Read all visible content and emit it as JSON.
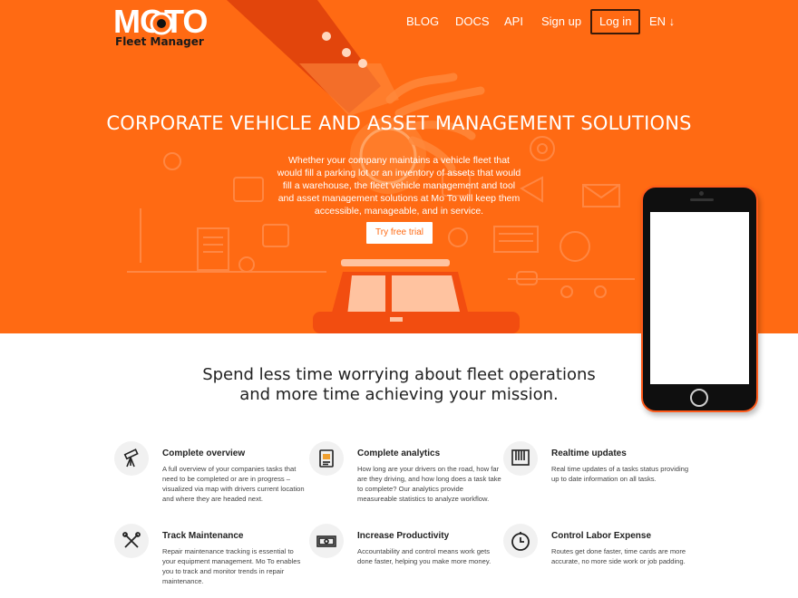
{
  "header": {
    "logo_text": "MOTO",
    "logo_sub": "Fleet Manager",
    "nav": {
      "blog": "BLOG",
      "docs": "DOCS",
      "api": "API",
      "signup": "Sign up",
      "login": "Log in",
      "lang": "EN ↓"
    }
  },
  "hero": {
    "title": "CORPORATE VEHICLE AND ASSET MANAGEMENT SOLUTIONS",
    "text": "Whether your company maintains a vehicle fleet that would fill a parking lot or an inventory of assets that would fill a warehouse, the fleet vehicle management and tool and asset management solutions at Mo To will keep them accessible, manageable, and in service.",
    "cta": "Try free trial"
  },
  "section": {
    "headline_1": "Spend less time worrying about fleet operations",
    "headline_2": "and more time achieving your mission."
  },
  "features": [
    {
      "title": "Complete overview",
      "icon": "telescope-icon",
      "text": "A full overview of your companies tasks that need to be completed or are in progress – visualized via map with drivers current location and where they are headed next."
    },
    {
      "title": "Complete analytics",
      "icon": "report-icon",
      "text": "How long are your drivers on the road, how far are they driving, and how long does a task take to complete? Our analytics provide measureable statistics to analyze workflow."
    },
    {
      "title": "Realtime updates",
      "icon": "newtons-cradle-icon",
      "text": "Real time updates of a tasks status providing up to date information on all tasks."
    },
    {
      "title": "Track Maintenance",
      "icon": "tools-icon",
      "text": "Repair maintenance tracking is essential to your equipment management. Mo To enables you to track and monitor trends in repair maintenance."
    },
    {
      "title": "Increase Productivity",
      "icon": "money-icon",
      "text": "Accountability and control means work gets done faster, helping you make more money."
    },
    {
      "title": "Control Labor Expense",
      "icon": "clock-icon",
      "text": "Routes get done faster, time cards are more accurate, no more side work or job padding."
    }
  ],
  "colors": {
    "brand_orange": "#ff6a13",
    "dark_orange": "#ef4a0d"
  }
}
